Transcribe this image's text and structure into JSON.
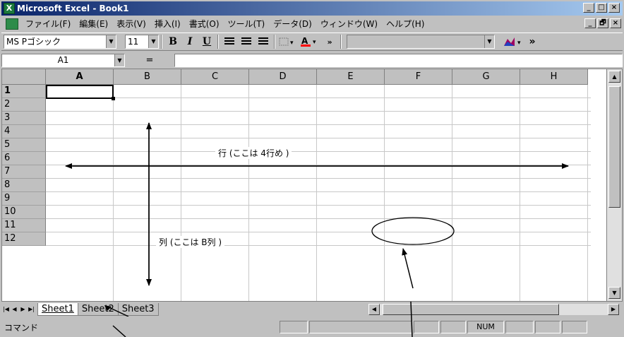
{
  "window": {
    "title": "Microsoft Excel - Book1",
    "caption_buttons": [
      "_",
      "□",
      "×"
    ],
    "doc_caption_buttons": [
      "_",
      "🗗",
      "×"
    ]
  },
  "menu": [
    "ファイル(F)",
    "編集(E)",
    "表示(V)",
    "挿入(I)",
    "書式(O)",
    "ツール(T)",
    "データ(D)",
    "ウィンドウ(W)",
    "ヘルプ(H)"
  ],
  "toolbar": {
    "font_name": "MS Pゴシック",
    "font_size": "11",
    "bold": "B",
    "italic": "I",
    "underline": "U",
    "more": "»"
  },
  "formula_bar": {
    "name_box": "A1",
    "equals": "=",
    "formula": ""
  },
  "grid": {
    "columns": [
      "A",
      "B",
      "C",
      "D",
      "E",
      "F",
      "G",
      "H"
    ],
    "rows": [
      "1",
      "2",
      "3",
      "4",
      "5",
      "6",
      "7",
      "8",
      "9",
      "10",
      "11",
      "12"
    ],
    "active_cell": "A1"
  },
  "annotations": {
    "row_label": "行 (ここは 4行め )",
    "col_label": "列 (ここは B列 )"
  },
  "sheet_tabs": [
    "Sheet1",
    "Sheet2",
    "Sheet3"
  ],
  "active_sheet": "Sheet1",
  "status": {
    "mode": "コマンド",
    "num": "NUM"
  }
}
